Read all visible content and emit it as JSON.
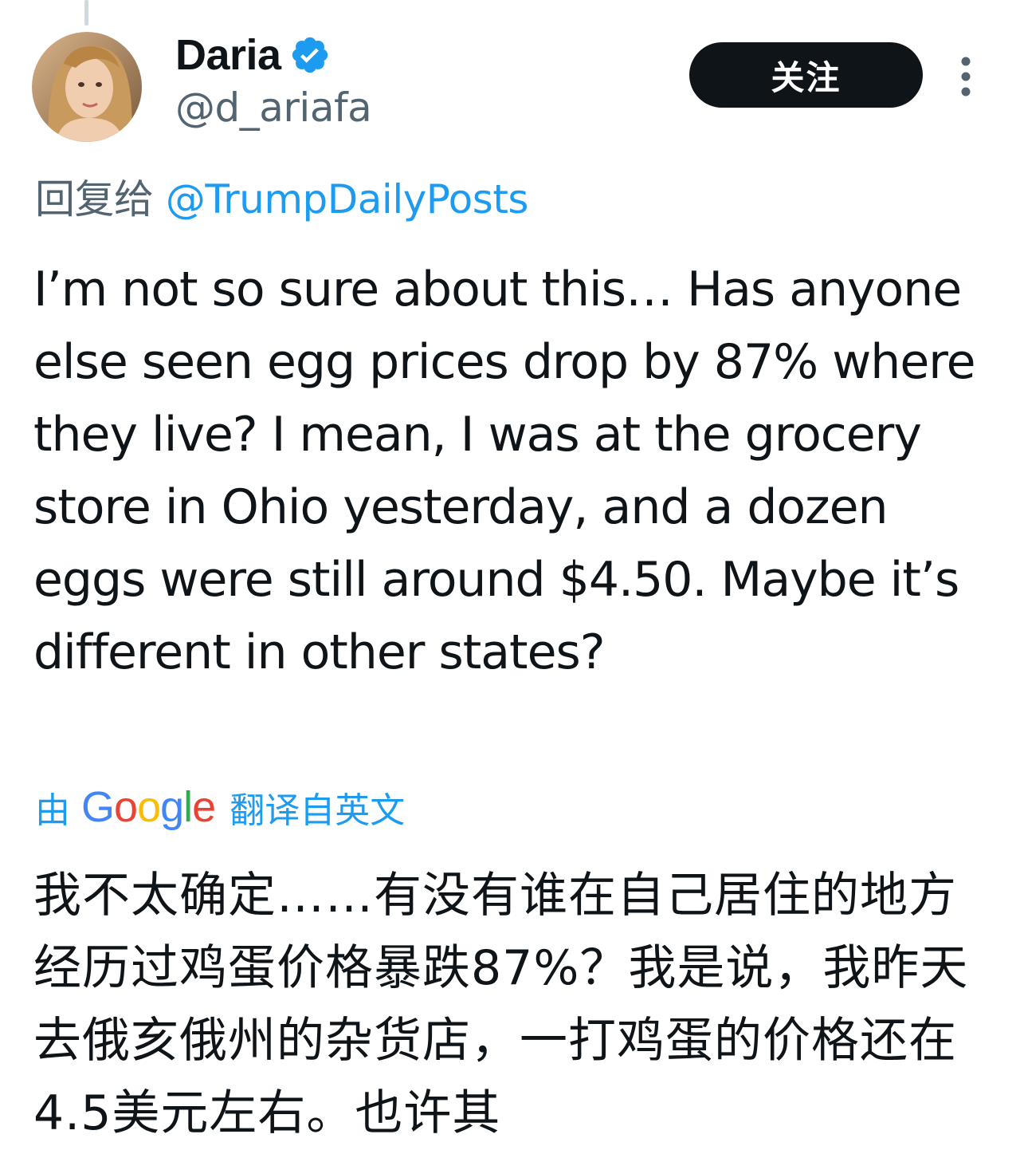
{
  "tweet": {
    "author": {
      "display_name": "Daria",
      "handle": "@d_ariafa",
      "verified": true
    },
    "follow_label": "关注",
    "reply_prefix": "回复给",
    "reply_to": "@TrumpDailyPosts",
    "text": "I’m not so sure about this… Has anyone else seen egg prices drop by 87% where they live? I mean, I was at the grocery store in Ohio yesterday, and a dozen eggs were still around $4.50. Maybe it’s different in other states?",
    "translation": {
      "prefix": "由",
      "provider": "Google",
      "suffix": "翻译自英文",
      "text": "我不太确定……有没有谁在自己居住的地方经历过鸡蛋价格暴跌87%？我是说，我昨天去俄亥俄州的杂货店，一打鸡蛋的价格还在4.5美元左右。也许其"
    }
  },
  "colors": {
    "text": "#0f1419",
    "secondary": "#536471",
    "link": "#1d9bf0",
    "follow_bg": "#0f1419",
    "google_blue": "#4285f4",
    "google_red": "#ea4335",
    "google_yellow": "#fbbc05",
    "google_green": "#34a853"
  },
  "icons": {
    "verified": "verified-badge-icon",
    "more": "more-vertical-icon"
  }
}
